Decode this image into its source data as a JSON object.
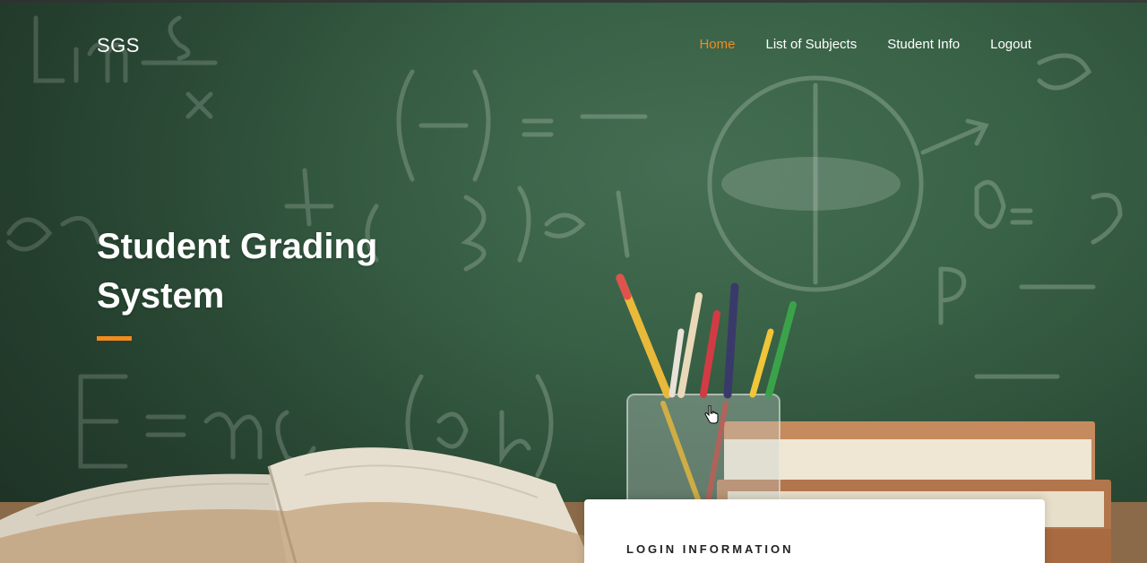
{
  "header": {
    "brand": "SGS",
    "nav": [
      {
        "label": "Home",
        "active": true
      },
      {
        "label": "List of Subjects",
        "active": false
      },
      {
        "label": "Student Info",
        "active": false
      },
      {
        "label": "Logout",
        "active": false
      }
    ]
  },
  "hero": {
    "title_line1": "Student Grading",
    "title_line2": "System",
    "accent_color": "#f28a1e"
  },
  "login": {
    "heading": "LOGIN INFORMATION"
  },
  "colors": {
    "accent": "#f28a1e",
    "chalkboard": "#3d6a4c",
    "card": "#ffffff"
  }
}
